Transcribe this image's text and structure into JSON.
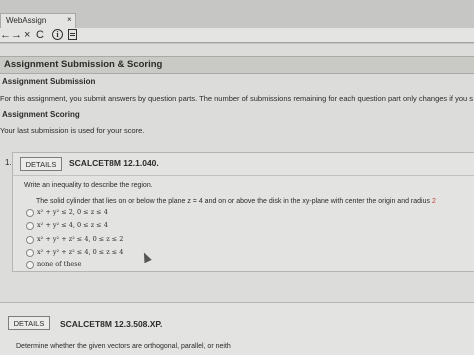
{
  "browser": {
    "tab_title": "WebAssign",
    "tab_close": "×",
    "back": "←",
    "forward": "→",
    "stop": "×",
    "reload": "C",
    "info": "i"
  },
  "page": {
    "title": "Assignment Submission & Scoring",
    "submission_heading": "Assignment Submission",
    "submission_text": "For this assignment, you submit answers by question parts. The number of submissions remaining for each question part only changes if you s",
    "scoring_heading": "Assignment Scoring",
    "scoring_text": "Your last submission is used for your score."
  },
  "question1": {
    "number": "1.",
    "details_label": "DETAILS",
    "code": "SCALCET8M 12.1.040.",
    "prompt": "Write an inequality to describe the region.",
    "description": "The solid cylinder that lies on or below the plane z = 4 and on or above the disk in the xy-plane with center the origin and radius",
    "radius_value": "2",
    "options": [
      "x² + y² ≤ 2, 0 ≤ z ≤ 4",
      "x² + y² ≤ 4, 0 ≤ z ≤ 4",
      "x² + y² + z² ≤ 4, 0 ≤ z ≤ 2",
      "x² + y² + z² ≤ 4, 0 ≤ z ≤ 4",
      "none of these"
    ]
  },
  "question2": {
    "details_label": "DETAILS",
    "code": "SCALCET8M 12.3.508.XP.",
    "prompt": "Determine whether the given vectors are orthogonal, parallel, or neith"
  }
}
